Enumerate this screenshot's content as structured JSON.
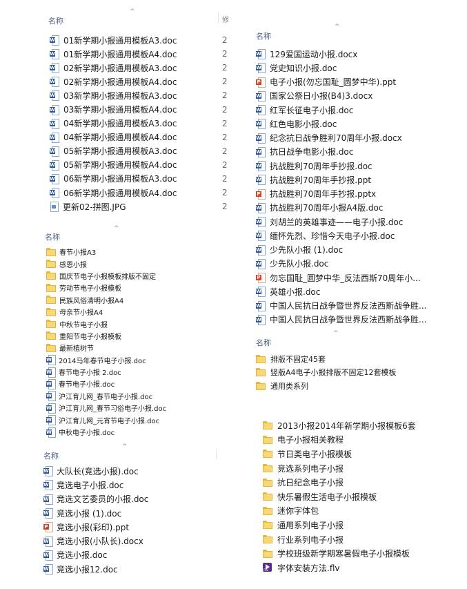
{
  "header_name": "名称",
  "sort_glyph": "^",
  "colors": {
    "word": "#2b5797",
    "ppt": "#d24726",
    "folder": "#f8d775",
    "header": "#4d6082"
  },
  "panel1": {
    "col_char": "修",
    "files": [
      {
        "icon": "word",
        "name": "01新学期小报通用模板A3.doc",
        "right": "2"
      },
      {
        "icon": "word",
        "name": "01新学期小报通用模板A4.doc",
        "right": "2"
      },
      {
        "icon": "word",
        "name": "02新学期小报通用模板A3.doc",
        "right": "2"
      },
      {
        "icon": "word",
        "name": "02新学期小报通用模板A4.doc",
        "right": "2"
      },
      {
        "icon": "word",
        "name": "03新学期小报通用模板A3.doc",
        "right": "2"
      },
      {
        "icon": "word",
        "name": "03新学期小报通用模板A4.doc",
        "right": "2"
      },
      {
        "icon": "word",
        "name": "04新学期小报通用模板A3.doc",
        "right": "2"
      },
      {
        "icon": "word",
        "name": "04新学期小报通用模板A4.doc",
        "right": "2"
      },
      {
        "icon": "word",
        "name": "05新学期小报通用模板A3.doc",
        "right": "2"
      },
      {
        "icon": "word",
        "name": "05新学期小报通用模板A4.doc",
        "right": "2"
      },
      {
        "icon": "word",
        "name": "06新学期小报通用模板A3.doc",
        "right": "2"
      },
      {
        "icon": "word",
        "name": "06新学期小报通用模板A4.doc",
        "right": "2"
      },
      {
        "icon": "jpg",
        "name": "更新02-拼图.JPG",
        "right": "2"
      }
    ]
  },
  "panel2": {
    "files": [
      {
        "icon": "word",
        "name": "129爱国运动小报.docx"
      },
      {
        "icon": "word",
        "name": "党史知识小报.doc"
      },
      {
        "icon": "ppt",
        "name": "电子小报(勿忘国耻_圆梦中华).ppt"
      },
      {
        "icon": "word",
        "name": "国家公祭日小报(B4)3.docx"
      },
      {
        "icon": "word",
        "name": "红军长征电子小报.doc"
      },
      {
        "icon": "word",
        "name": "红色电影小报.doc"
      },
      {
        "icon": "word",
        "name": "纪念抗日战争胜利70周年小报.docx"
      },
      {
        "icon": "word",
        "name": "抗日战争电影小报.doc"
      },
      {
        "icon": "word",
        "name": "抗战胜利70周年手抄报.doc"
      },
      {
        "icon": "word",
        "name": "抗战胜利70周年手抄报.ppt"
      },
      {
        "icon": "ppt",
        "name": "抗战胜利70周年手抄报.pptx"
      },
      {
        "icon": "word",
        "name": "抗战胜利70周年小报A4版.doc"
      },
      {
        "icon": "word",
        "name": "刘胡兰的英雄事迹——电子小报.doc"
      },
      {
        "icon": "word",
        "name": "缅怀先烈、珍惜今天电子小报.doc"
      },
      {
        "icon": "word",
        "name": "少先队小报 (1).doc"
      },
      {
        "icon": "word",
        "name": "少先队小报.doc"
      },
      {
        "icon": "ppt",
        "name": "勿忘国耻_圆梦中华_反法西斯70周年小..."
      },
      {
        "icon": "word",
        "name": "英雄小报.doc"
      },
      {
        "icon": "word",
        "name": "中国人民抗日战争暨世界反法西斯战争胜..."
      },
      {
        "icon": "word",
        "name": "中国人民抗日战争暨世界反法西斯战争胜..."
      }
    ]
  },
  "panel3": {
    "files": [
      {
        "icon": "folder",
        "name": "春节小报A3"
      },
      {
        "icon": "folder",
        "name": "感恩小报"
      },
      {
        "icon": "folder",
        "name": "国庆节电子小报模板排版不固定"
      },
      {
        "icon": "folder",
        "name": "劳动节电子小报模板"
      },
      {
        "icon": "folder",
        "name": "民族风俗清明小报A4"
      },
      {
        "icon": "folder",
        "name": "母亲节小报A4"
      },
      {
        "icon": "folder",
        "name": "中秋节电子小报"
      },
      {
        "icon": "folder",
        "name": "重阳节电子小报模板"
      },
      {
        "icon": "folder",
        "name": "最新植树节"
      },
      {
        "icon": "word",
        "name": "2014马年春节电子小报.doc"
      },
      {
        "icon": "word",
        "name": "春节电子小报 2.doc"
      },
      {
        "icon": "word",
        "name": "春节电子小报.doc"
      },
      {
        "icon": "word",
        "name": "沪江育儿网_春节电子小报.doc"
      },
      {
        "icon": "word",
        "name": "沪江育儿网_春节习俗电子小报.doc"
      },
      {
        "icon": "word",
        "name": "沪江育儿网_元宵节电子小报.doc"
      },
      {
        "icon": "word",
        "name": "中秋电子小报.doc"
      }
    ]
  },
  "panel4": {
    "files": [
      {
        "icon": "folder",
        "name": "排版不固定45套"
      },
      {
        "icon": "folder",
        "name": "竖版A4电子小报排版不固定12套模板"
      },
      {
        "icon": "folder",
        "name": "通用类系列"
      }
    ]
  },
  "panel5": {
    "files": [
      {
        "icon": "word",
        "name": "大队长(竞选小报).doc"
      },
      {
        "icon": "word",
        "name": "竞选电子小报.doc"
      },
      {
        "icon": "word",
        "name": "竞选文艺委员的小报.doc"
      },
      {
        "icon": "word",
        "name": "竞选小报 (1).doc"
      },
      {
        "icon": "ppt",
        "name": "竞选小报(彩印).ppt"
      },
      {
        "icon": "word",
        "name": "竞选小报(小队长).docx"
      },
      {
        "icon": "word",
        "name": "竞选小报.doc"
      },
      {
        "icon": "word",
        "name": "竞选小报12.doc"
      }
    ]
  },
  "panel6": {
    "files": [
      {
        "icon": "folder",
        "name": "2013小报2014年新学期小报模板6套"
      },
      {
        "icon": "folder",
        "name": "电子小报相关教程"
      },
      {
        "icon": "folder",
        "name": "节日类电子小报模板"
      },
      {
        "icon": "folder",
        "name": "竞选系列电子小报"
      },
      {
        "icon": "folder",
        "name": "抗日纪念电子小报"
      },
      {
        "icon": "folder",
        "name": "快乐暑假生活电子小报模板"
      },
      {
        "icon": "folder",
        "name": "迷你字体包"
      },
      {
        "icon": "folder",
        "name": "通用系列电子小报"
      },
      {
        "icon": "folder",
        "name": "行业系列电子小报"
      },
      {
        "icon": "folder",
        "name": "学校班级新学期寒暑假电子小报模板"
      },
      {
        "icon": "flv",
        "name": "字体安装方法.flv"
      }
    ]
  }
}
